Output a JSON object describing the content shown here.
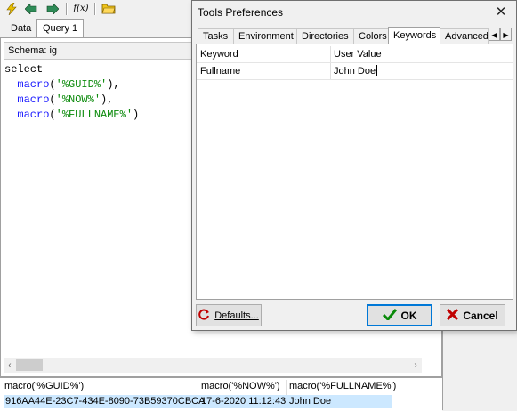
{
  "toolbar": {
    "icons": [
      "lightning-icon",
      "back-arrow-icon",
      "forward-arrow-icon",
      "function-icon",
      "folder-icon"
    ],
    "function_glyph": "f(x)"
  },
  "tabs": [
    {
      "label": "Data",
      "active": false
    },
    {
      "label": "Query 1",
      "active": true
    }
  ],
  "schema": {
    "label": "Schema: ig"
  },
  "code": {
    "line1": "select",
    "macro": "macro",
    "args": [
      "'%GUID%'",
      "'%NOW%'",
      "'%FULLNAME%'"
    ]
  },
  "results": {
    "headers": [
      "macro('%GUID%')",
      "macro('%NOW%')",
      "macro('%FULLNAME%')"
    ],
    "row": [
      "916AA44E-23C7-434E-8090-73B59370CBCA",
      "17-6-2020 11:12:43",
      "John Doe"
    ]
  },
  "dialog": {
    "title": "Tools Preferences",
    "close_glyph": "✕",
    "tabs": [
      "Tasks",
      "Environment",
      "Directories",
      "Colors",
      "Keywords",
      "Advanced"
    ],
    "selected_tab": "Keywords",
    "grid": {
      "headers": [
        "Keyword",
        "User Value"
      ],
      "rows": [
        [
          "Fullname",
          "John Doe"
        ]
      ]
    },
    "buttons": {
      "defaults": "Defaults...",
      "ok": "OK",
      "cancel": "Cancel"
    }
  },
  "colors": {
    "selection": "#cce8ff",
    "ok_check": "#0a8a0a",
    "cancel_x": "#c00000",
    "focus_border": "#0078d7"
  }
}
